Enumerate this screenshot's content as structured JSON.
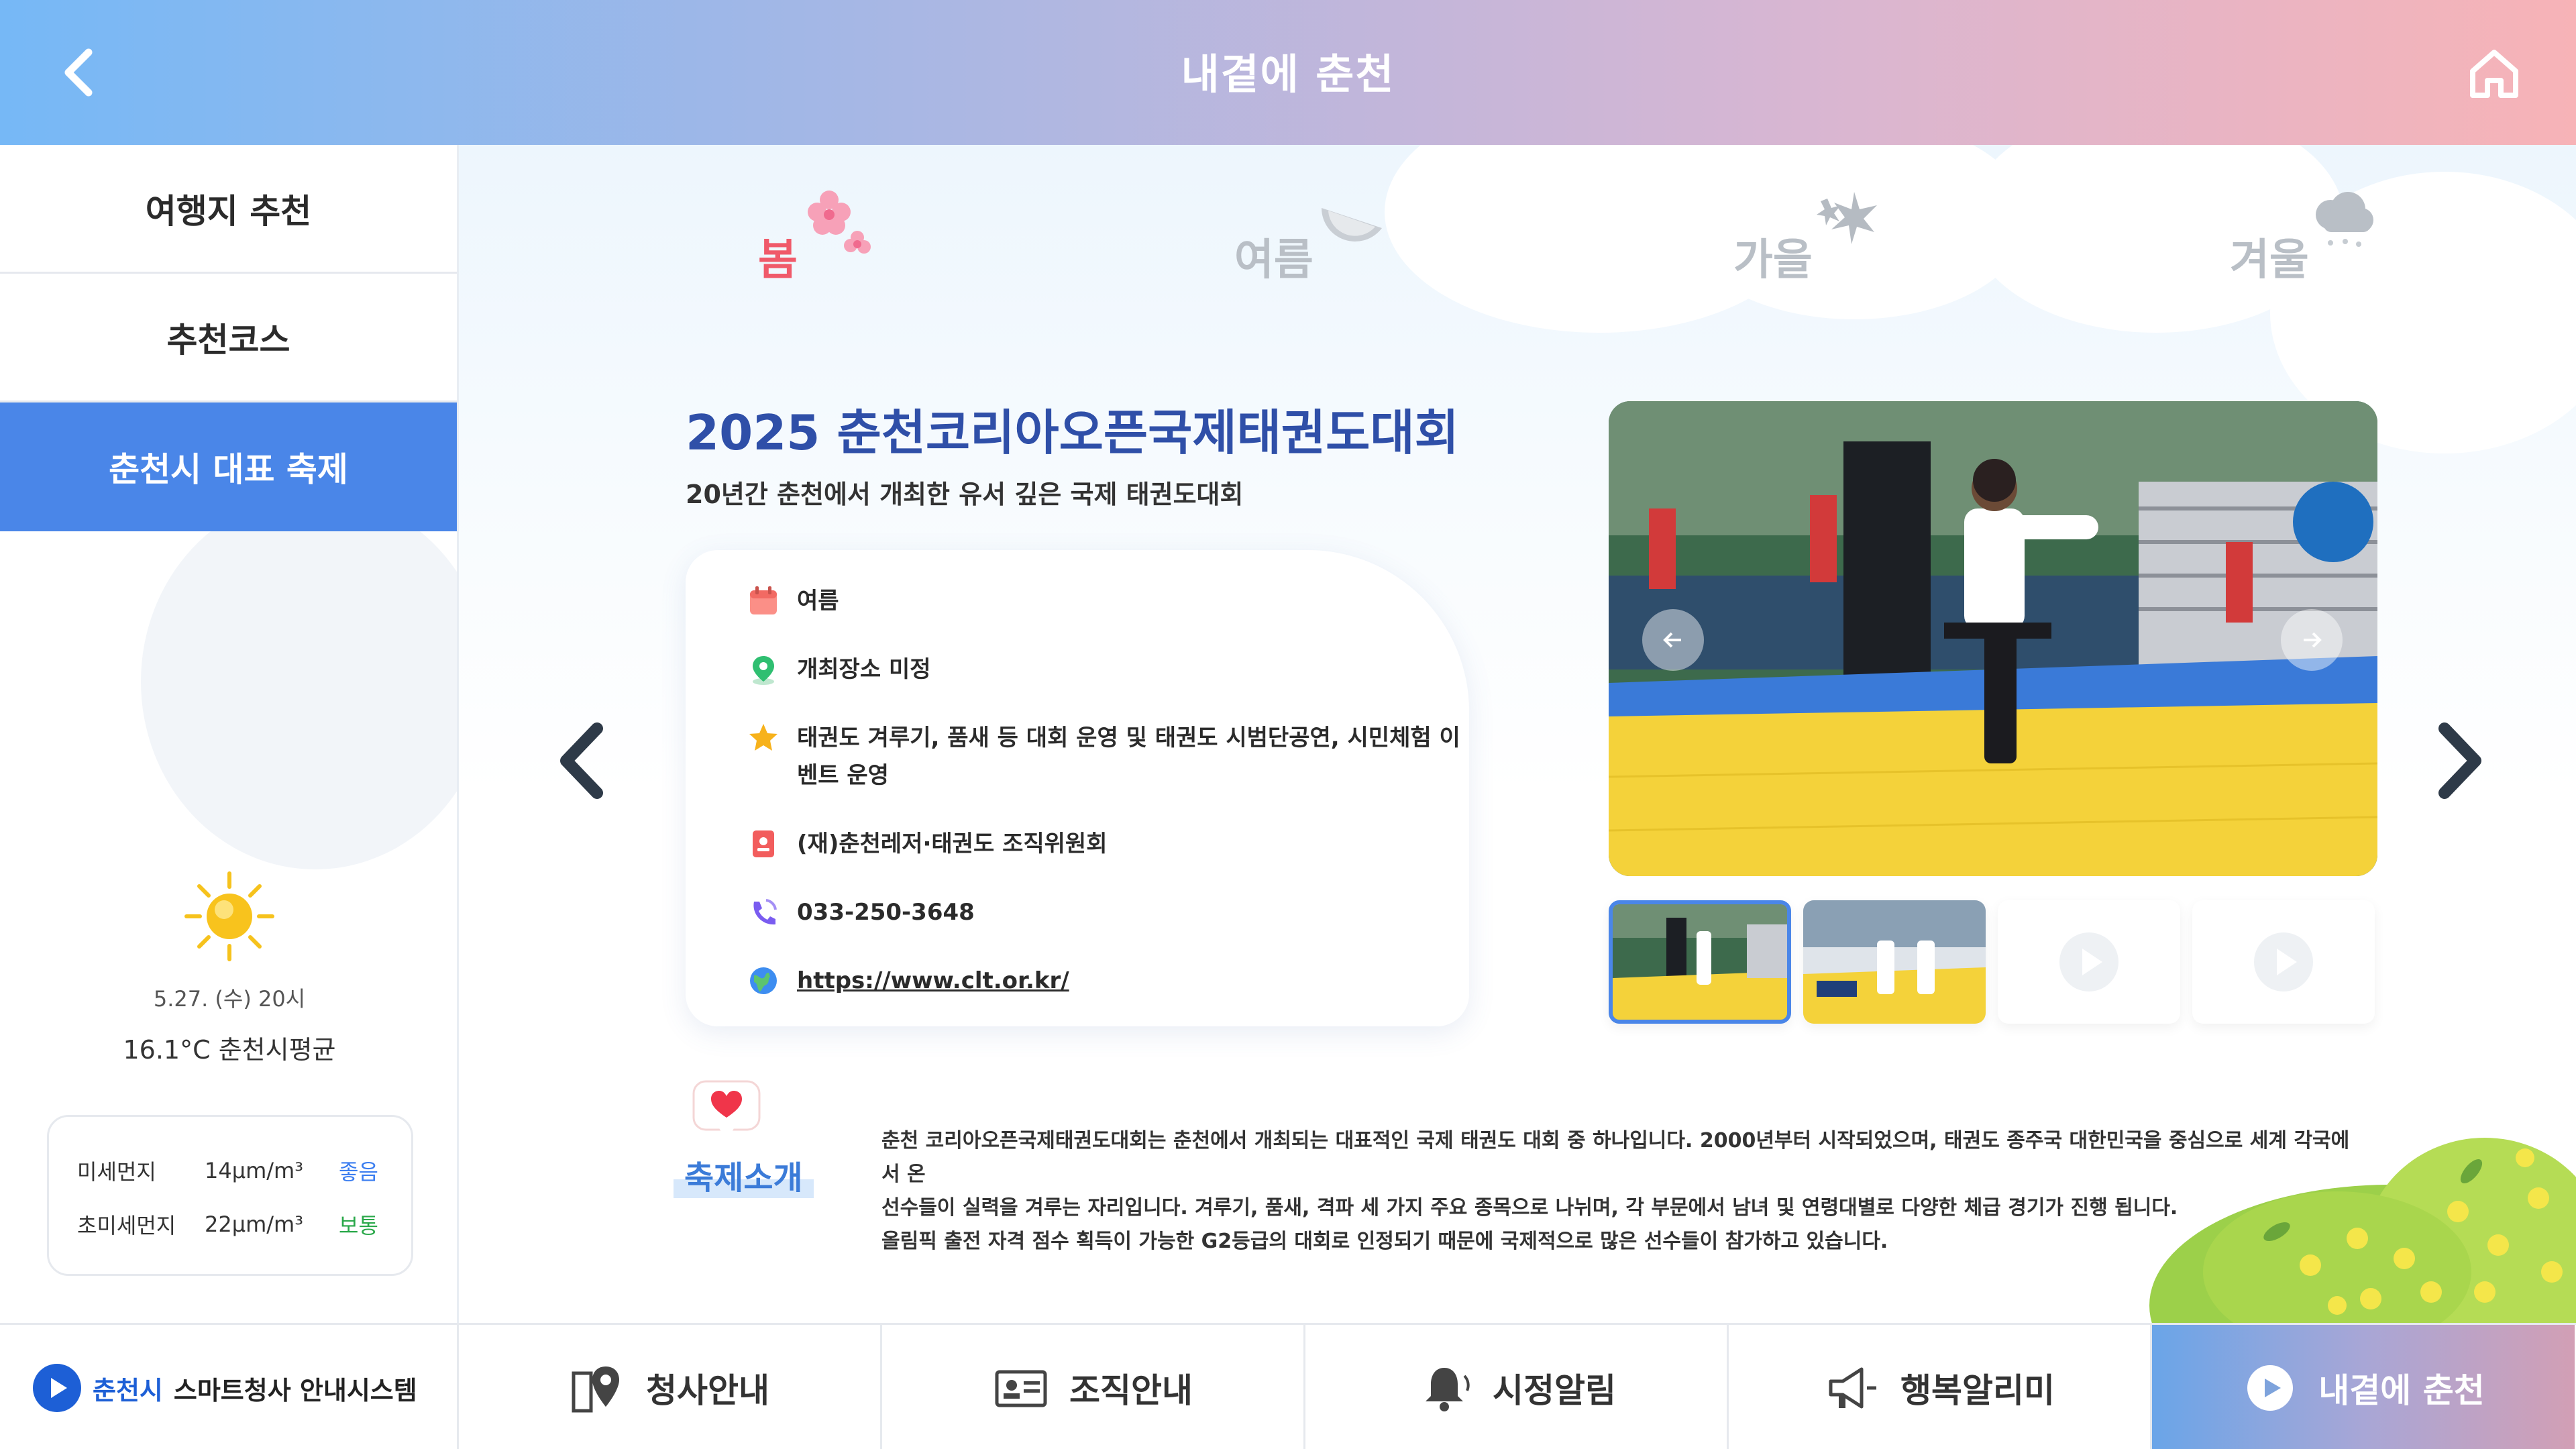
{
  "header": {
    "title": "내곁에 춘천"
  },
  "sidebar": {
    "items": [
      {
        "label": "여행지 추천"
      },
      {
        "label": "추천코스"
      },
      {
        "label": "춘천시 대표 축제"
      }
    ],
    "weather": {
      "date": "5.27. (수) 20시",
      "temp": "16.1°C 춘천시평균",
      "icon": "sun-icon"
    },
    "dust": [
      {
        "name": "미세먼지",
        "value": "14μm/m³",
        "status": "좋음",
        "color": "#3a7df0"
      },
      {
        "name": "초미세먼지",
        "value": "22μm/m³",
        "status": "보통",
        "color": "#2aa84a"
      }
    ]
  },
  "seasons": [
    {
      "label": "봄",
      "active": true
    },
    {
      "label": "여름",
      "active": false
    },
    {
      "label": "가을",
      "active": false
    },
    {
      "label": "겨울",
      "active": false
    }
  ],
  "festival": {
    "title": "2025 춘천코리아오픈국제태권도대회",
    "subtitle": "20년간 춘천에서 개최한 유서 깊은 국제 태권도대회",
    "season": "여름",
    "place": "개최장소 미정",
    "program": "태권도 겨루기, 품새 등 대회 운영 및 태권도 시범단공연, 시민체험 이벤트 운영",
    "organizer": "(재)춘천레저·태권도 조직위원회",
    "phone": "033-250-3648",
    "url": "https://www.clt.or.kr/"
  },
  "intro": {
    "label": "축제소개",
    "lines": [
      "춘천 코리아오픈국제태권도대회는 춘천에서 개최되는 대표적인 국제 태권도 대회 중 하나입니다. 2000년부터 시작되었으며, 태권도 종주국 대한민국을 중심으로 세계 각국에서 온",
      "선수들이 실력을 겨루는 자리입니다. 겨루기, 품새, 격파 세 가지 주요 종목으로 나뉘며, 각 부문에서 남녀 및 연령대별로 다양한 체급 경기가 진행 됩니다.",
      "올림픽 출전 자격 점수 획득이 가능한 G2등급의 대회로 인정되기 때문에 국제적으로 많은 선수들이 참가하고 있습니다."
    ]
  },
  "bottom": {
    "brand_city": "춘천시",
    "brand_name": "스마트청사 안내시스템",
    "tabs": [
      {
        "label": "청사안내",
        "icon": "map-pin-icon"
      },
      {
        "label": "조직안내",
        "icon": "id-card-icon"
      },
      {
        "label": "시정알림",
        "icon": "bell-icon"
      },
      {
        "label": "행복알리미",
        "icon": "megaphone-icon"
      },
      {
        "label": "내곁에 춘천",
        "icon": "chuncheon-logo-icon",
        "active": true
      }
    ]
  },
  "colors": {
    "accent": "#4a86e8",
    "title": "#2f4fa8",
    "spring": "#f05a6a"
  }
}
